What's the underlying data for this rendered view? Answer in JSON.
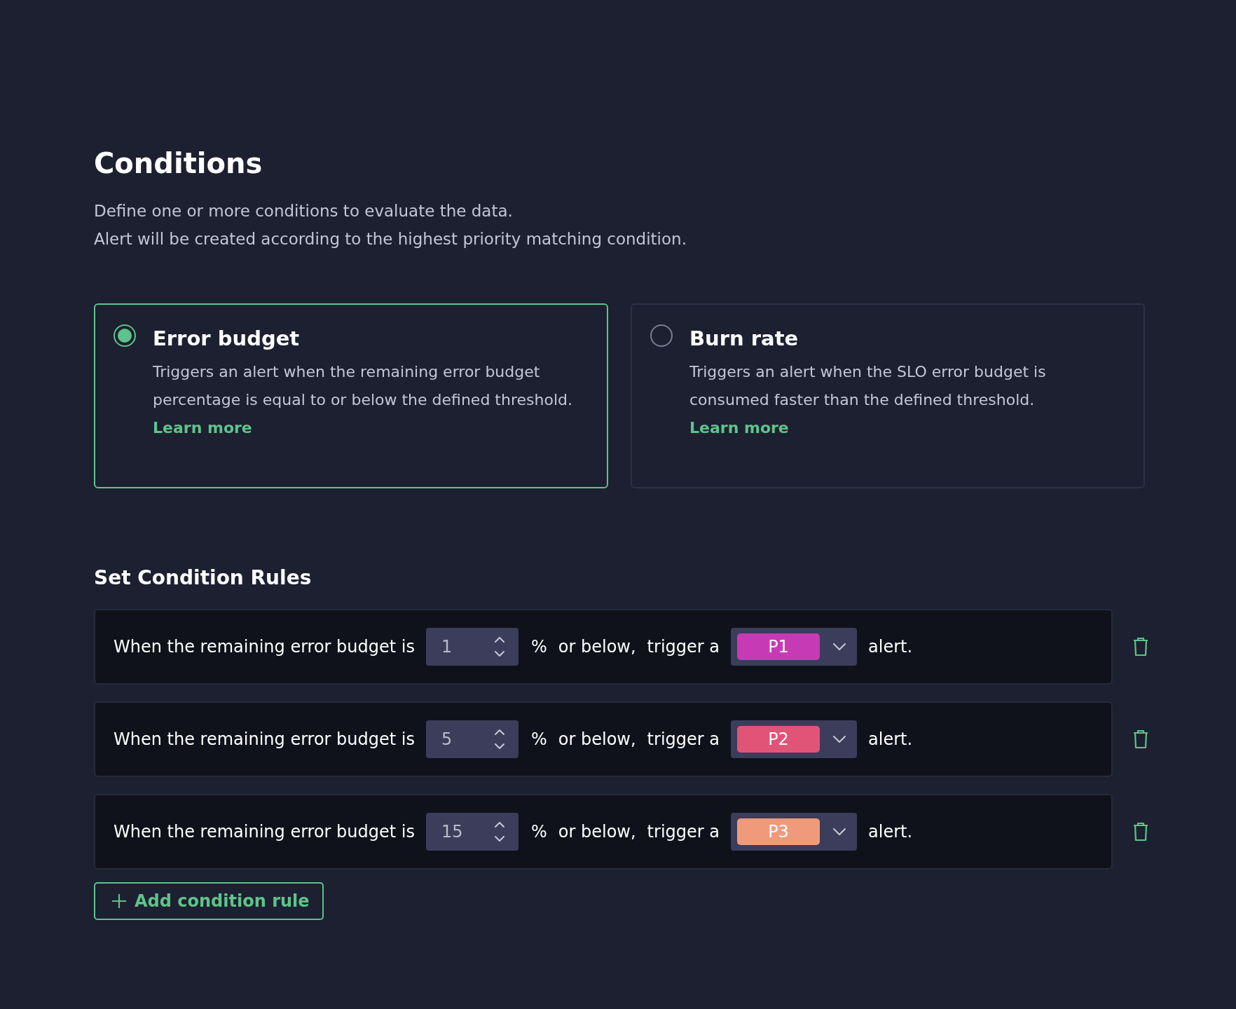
{
  "heading": "Conditions",
  "description": [
    "Define one or more conditions to evaluate the data.",
    "Alert will be created according to the highest priority matching condition."
  ],
  "condition_types": [
    {
      "title": "Error budget",
      "selected": true,
      "description": "Triggers an alert when the remaining error budget percentage is equal to or below the defined threshold.",
      "link": "Learn more"
    },
    {
      "title": "Burn rate",
      "selected": false,
      "description": "Triggers an alert when the SLO error budget is consumed faster than the defined threshold.",
      "link": "Learn more"
    }
  ],
  "rules_heading": "Set Condition Rules",
  "rules": [
    {
      "prefix": "When the remaining error budget is",
      "value": "1",
      "unit": "%",
      "comparison": "or below,",
      "trigger": "trigger a",
      "priority": "P1",
      "color": "#c63bb5",
      "suffix": "alert."
    },
    {
      "prefix": "When the remaining error budget is",
      "value": "5",
      "unit": "%",
      "comparison": "or below,",
      "trigger": "trigger a",
      "priority": "P2",
      "color": "#e05577",
      "suffix": "alert."
    },
    {
      "prefix": "When the remaining error budget is",
      "value": "15",
      "unit": "%",
      "comparison": "or below,",
      "trigger": "trigger a",
      "priority": "P3",
      "color": "#f09a7c",
      "suffix": "alert."
    }
  ],
  "add_button": "Add condition rule"
}
